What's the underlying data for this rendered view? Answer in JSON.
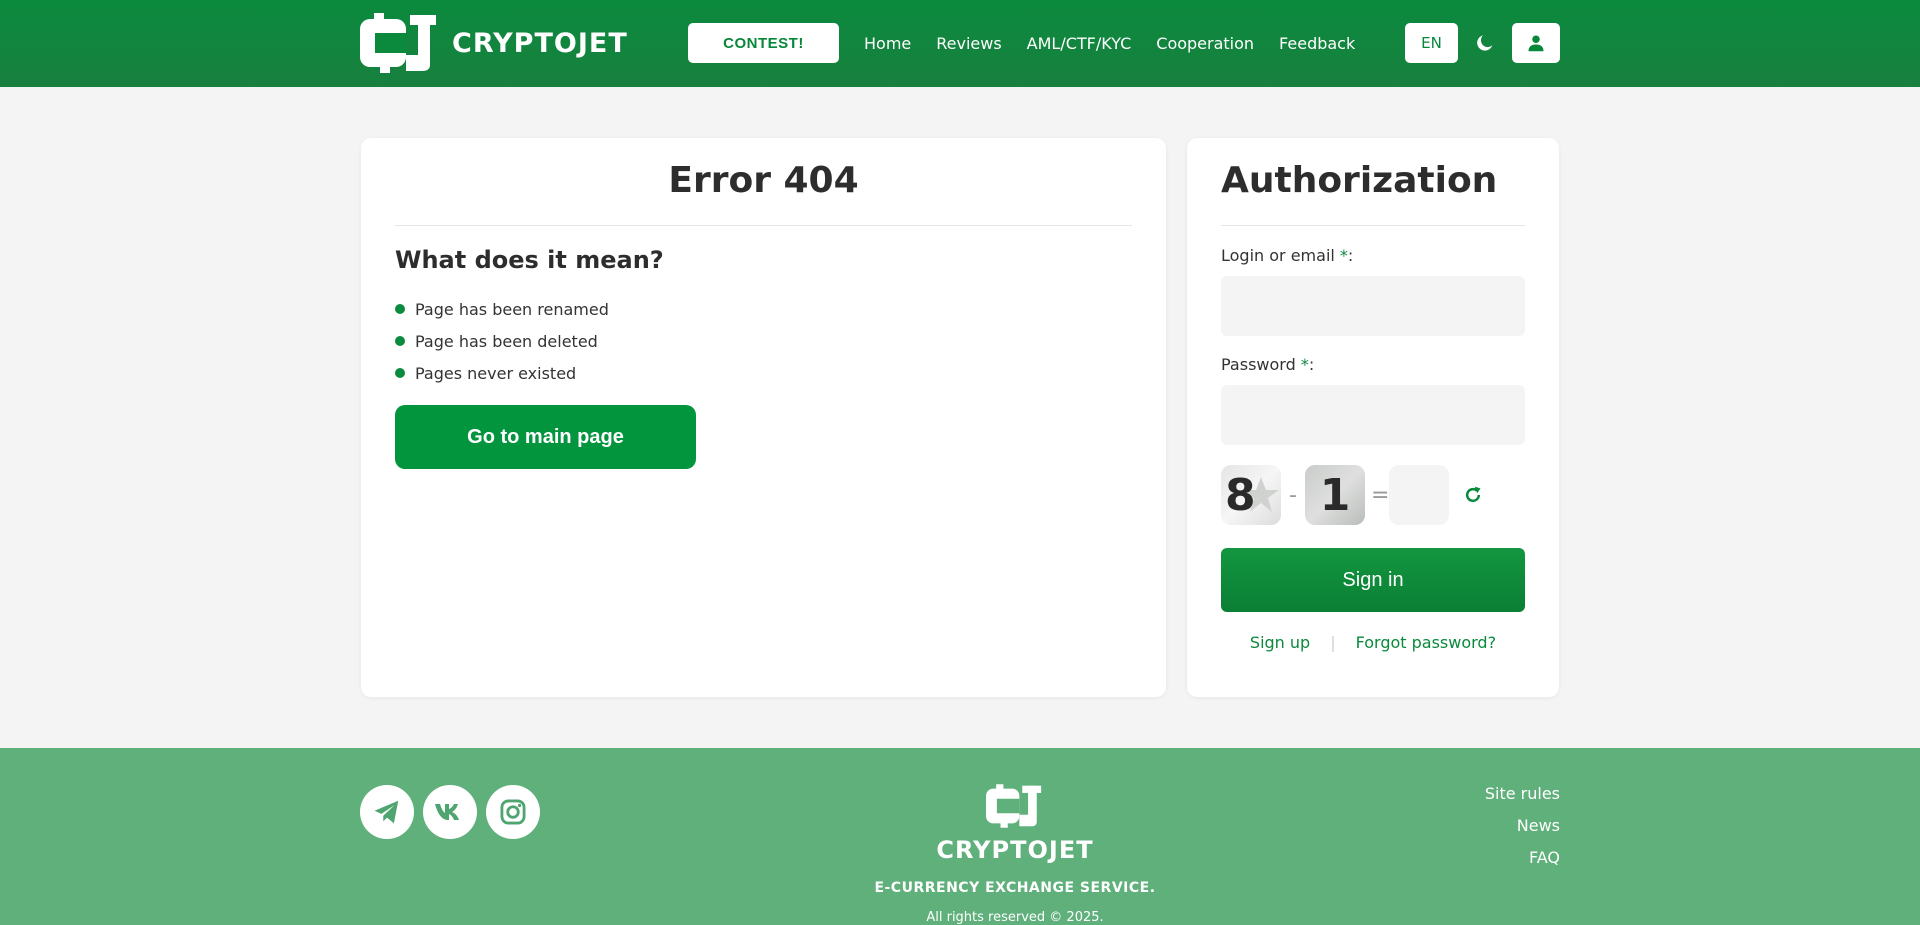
{
  "header": {
    "brand": "CRYPTOJET",
    "contest_label": "CONTEST!",
    "nav": [
      "Home",
      "Reviews",
      "AML/CTF/KYC",
      "Cooperation",
      "Feedback"
    ],
    "lang": "EN"
  },
  "error": {
    "title": "Error 404",
    "subtitle": "What does it mean?",
    "reasons": [
      "Page has been renamed",
      "Page has been deleted",
      "Pages never existed"
    ],
    "main_button": "Go to main page"
  },
  "auth": {
    "title": "Authorization",
    "login_label": "Login or email ",
    "password_label": "Password ",
    "required_mark": "*",
    "colon": ":",
    "captcha": {
      "a": "8",
      "op": "-",
      "b": "1",
      "eq": "="
    },
    "signin_label": "Sign in",
    "signup_label": "Sign up",
    "separator": "|",
    "forgot_label": "Forgot password?"
  },
  "footer": {
    "brand": "CRYPTOJET",
    "tagline": "E-CURRENCY EXCHANGE SERVICE.",
    "copyright": "All rights reserved © 2025.",
    "links": [
      "Site rules",
      "News",
      "FAQ"
    ]
  },
  "icons": {
    "logo": "cryptojet-logo-icon",
    "theme": "moon-icon",
    "profile": "user-icon",
    "refresh": "refresh-icon",
    "socials": [
      "telegram-icon",
      "vk-icon",
      "instagram-icon"
    ]
  },
  "colors": {
    "brand_green": "#0b8a3d",
    "footer_green": "#60b07c",
    "button_green": "#03953e"
  }
}
